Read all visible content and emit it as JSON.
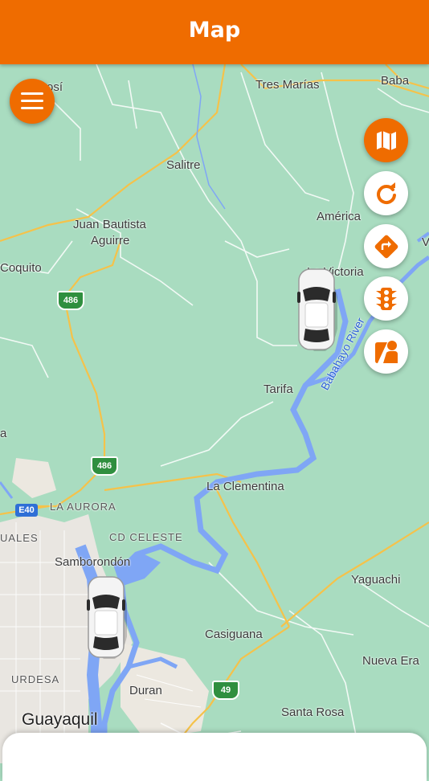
{
  "header": {
    "title": "Map"
  },
  "map": {
    "places": [
      {
        "id": "tres-marias",
        "text": "Tres Marías"
      },
      {
        "id": "baba",
        "text": "Baba"
      },
      {
        "id": "posi",
        "text": "osí"
      },
      {
        "id": "salitre",
        "text": "Salitre"
      },
      {
        "id": "america",
        "text": "América"
      },
      {
        "id": "juan-bautista",
        "text": "Juan Bautista"
      },
      {
        "id": "aguirre",
        "text": "Aguirre"
      },
      {
        "id": "coquito",
        "text": "Coquito"
      },
      {
        "id": "la-victoria",
        "text": "La Victoria"
      },
      {
        "id": "tarifa",
        "text": "Tarifa"
      },
      {
        "id": "la-clementina",
        "text": "La Clementina"
      },
      {
        "id": "la-aurora",
        "text": "LA AURORA"
      },
      {
        "id": "cd-celeste",
        "text": "CD CELESTE"
      },
      {
        "id": "uales",
        "text": "UALES"
      },
      {
        "id": "samborondon",
        "text": "Samborondón"
      },
      {
        "id": "yaguachi",
        "text": "Yaguachi"
      },
      {
        "id": "casiguana",
        "text": "Casiguana"
      },
      {
        "id": "nueva-era",
        "text": "Nueva Era"
      },
      {
        "id": "urdesa",
        "text": "URDESA"
      },
      {
        "id": "duran",
        "text": "Duran"
      },
      {
        "id": "santa-rosa",
        "text": "Santa Rosa"
      },
      {
        "id": "guayaquil",
        "text": "Guayaquil"
      },
      {
        "id": "edge-v",
        "text": "V"
      },
      {
        "id": "edge-a",
        "text": "a"
      }
    ],
    "river_label": "Babahayo River",
    "routes": {
      "r486a": "486",
      "r486b": "486",
      "e40": "E40",
      "r49": "49"
    }
  },
  "controls": [
    {
      "id": "map-type",
      "icon": "map-icon"
    },
    {
      "id": "refresh",
      "icon": "refresh-icon"
    },
    {
      "id": "directions",
      "icon": "directions-icon"
    },
    {
      "id": "traffic",
      "icon": "traffic-light-icon"
    },
    {
      "id": "street-view",
      "icon": "person-map-icon"
    }
  ],
  "colors": {
    "accent": "#ef6c00",
    "map_bg": "#a9dcc0",
    "water": "#7fa6f5",
    "road": "#f5c24a"
  }
}
